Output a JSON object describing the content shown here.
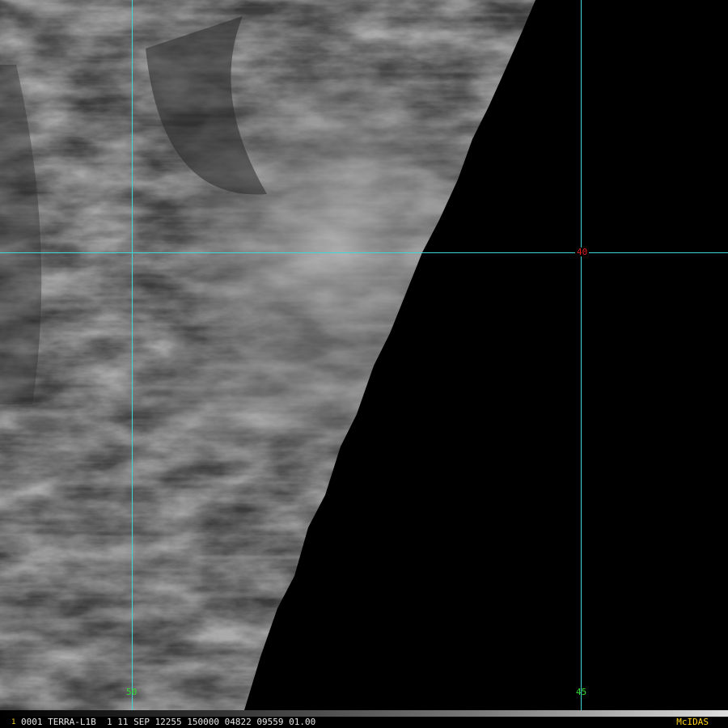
{
  "imagery": {
    "description_icon": "satellite-cloud-imagery",
    "swath_edge_color": "#000000"
  },
  "grid": {
    "line_color": "#3fd6d6",
    "lat_label": "40",
    "lon_label_west": "50",
    "lon_label_east": "45",
    "lat_label_color": "#e02020",
    "lon_label_color": "#33dd33"
  },
  "status_bar": {
    "frame_number": "1",
    "text": "0001 TERRA-L1B  1 11 SEP 12255 150000 04822 09559 01.00",
    "brand": "McIDAS",
    "brand_color": "#ffd21a"
  }
}
